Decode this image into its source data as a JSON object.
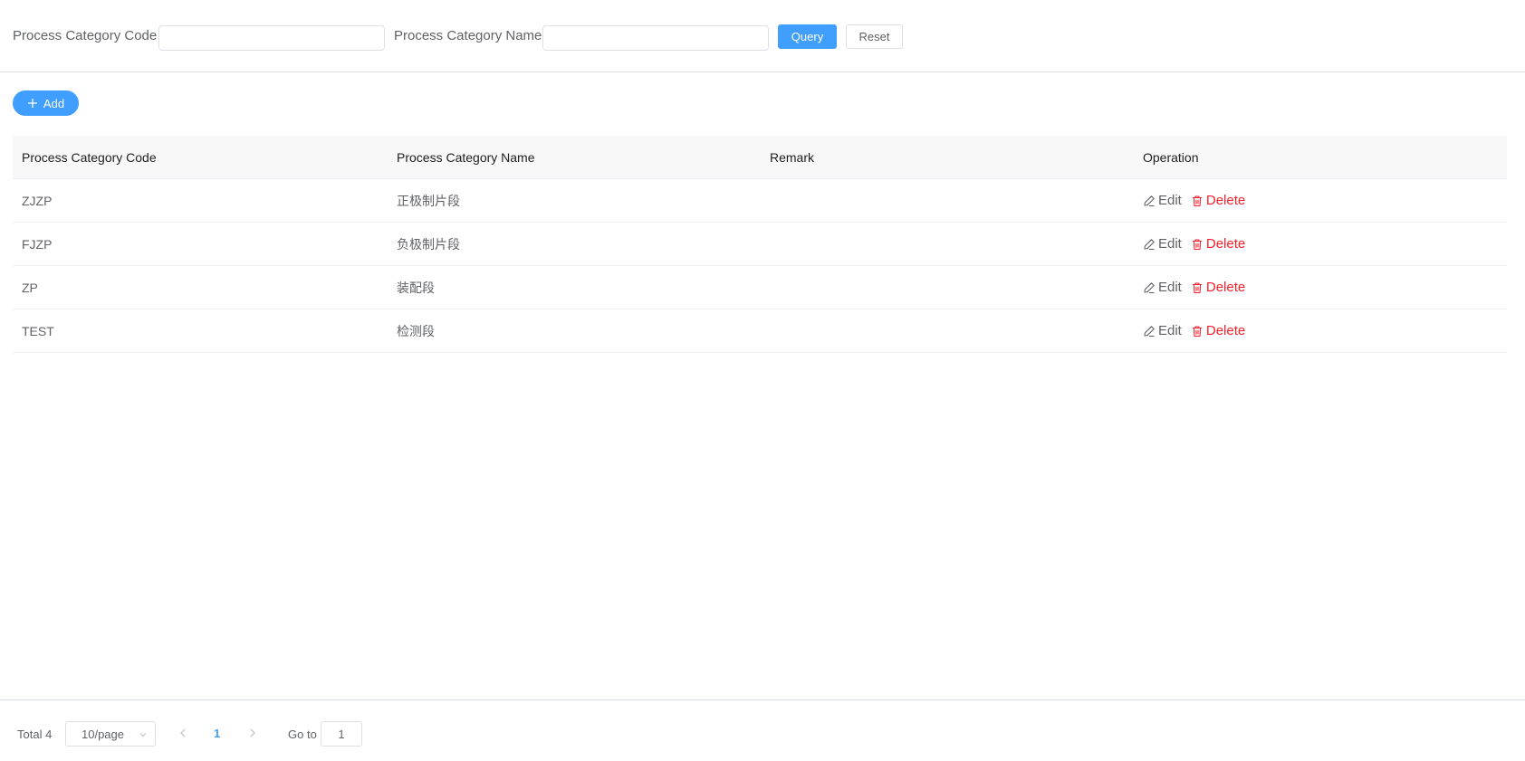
{
  "search": {
    "code_label": "Process Category Code",
    "code_value": "",
    "name_label": "Process Category Name",
    "name_value": "",
    "query_label": "Query",
    "reset_label": "Reset"
  },
  "toolbar": {
    "add_label": "Add"
  },
  "table": {
    "columns": [
      "Process Category Code",
      "Process Category Name",
      "Remark",
      "Operation"
    ],
    "rows": [
      {
        "code": "ZJZP",
        "name": "正极制片段",
        "remark": ""
      },
      {
        "code": "FJZP",
        "name": "负极制片段",
        "remark": ""
      },
      {
        "code": "ZP",
        "name": "装配段",
        "remark": ""
      },
      {
        "code": "TEST",
        "name": "检测段",
        "remark": ""
      }
    ],
    "edit_label": "Edit",
    "delete_label": "Delete"
  },
  "pagination": {
    "total_text": "Total 4",
    "page_size": "10/page",
    "current_page": "1",
    "goto_label": "Go to",
    "goto_value": "1"
  },
  "colors": {
    "primary": "#409eff",
    "danger": "#f5222d",
    "text": "#606266",
    "header_bg": "#f8f8f9"
  }
}
